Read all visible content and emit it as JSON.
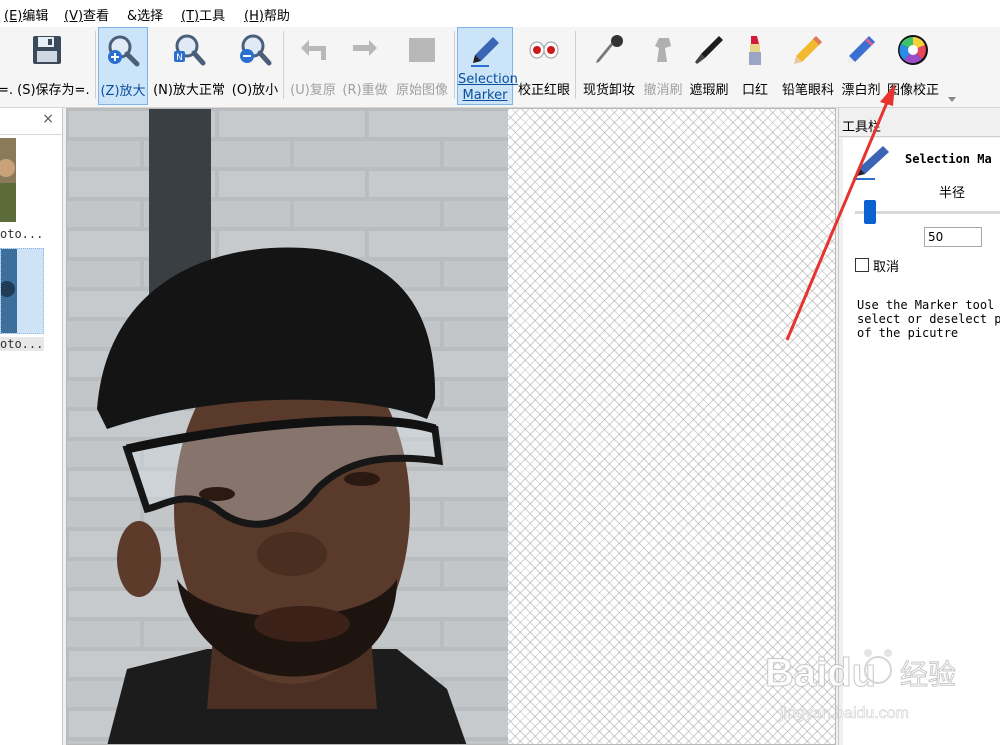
{
  "menu": {
    "edit": {
      "key": "(E)",
      "label": "编辑"
    },
    "view": {
      "key": "(V)",
      "label": "查看"
    },
    "select": {
      "key": "&",
      "label": "选择"
    },
    "tools": {
      "key": "(T)",
      "label": "工具"
    },
    "help": {
      "key": "(H)",
      "label": "帮助"
    }
  },
  "toolbar": {
    "save_as": "=. (S)保存为=.",
    "zoom_in": "(Z)放大",
    "zoom_normal": "(N)放大正常",
    "zoom_out": "(O)放小",
    "undo": "(U)复原",
    "redo": "(R)重做",
    "original": "原始图像",
    "selection_marker_1": "Selection",
    "selection_marker_2": "Marker",
    "red_eye": "校正红眼",
    "makeup": "现货卸妆",
    "cancel_brush": "撤消刷",
    "concealer": "遮瑕刷",
    "lipstick": "口红",
    "eyeliner": "铅笔眼科",
    "whitening": "漂白剂",
    "image_correct": "图像校正"
  },
  "left_panel": {
    "close": "×",
    "thumbs": [
      "oto...",
      "oto..."
    ]
  },
  "right_panel": {
    "title": "工具栏",
    "tool_name": "Selection Ma",
    "radius_label": "半径",
    "radius_value": "50",
    "radius_fraction": 0.1,
    "cancel_label": "取消",
    "help": [
      "Use the Marker tool",
      "select or deselect p",
      "of the picutre"
    ]
  },
  "watermark": {
    "brand": "Baidu",
    "cn": "经验",
    "url": "jingyan.baidu.com"
  },
  "colors": {
    "accent": "#0a62d0",
    "active_bg": "#cce4f7",
    "arrow": "#e8322d"
  }
}
